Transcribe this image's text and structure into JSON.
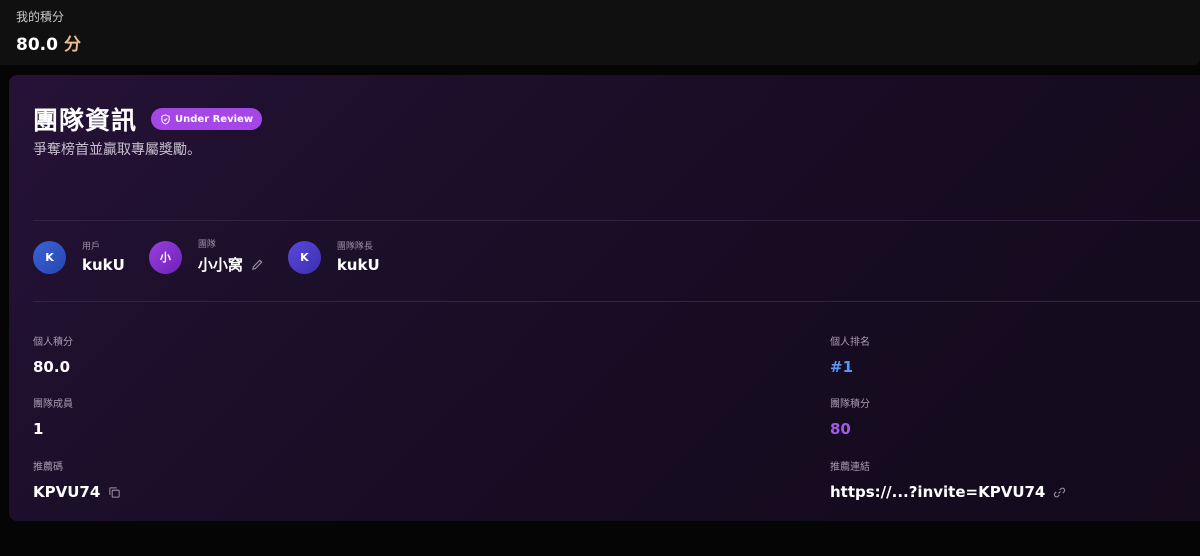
{
  "my_points": {
    "label": "我的積分",
    "value": "80.0",
    "unit": "分"
  },
  "team_card": {
    "title": "團隊資訊",
    "badge": "Under Review",
    "subtitle": "爭奪榜首並贏取專屬獎勵。",
    "members": [
      {
        "label": "用戶",
        "name": "kukU",
        "initial": "K",
        "icon": "avatar"
      },
      {
        "label": "團隊",
        "name": "小小窝",
        "initial": "小",
        "icon": "avatar",
        "edit_icon": "pencil-icon"
      },
      {
        "label": "團隊隊長",
        "name": "kukU",
        "initial": "K",
        "icon": "avatar"
      }
    ],
    "stats": {
      "personal_points": {
        "label": "個人積分",
        "value": "80.0"
      },
      "personal_rank": {
        "label": "個人排名",
        "value": "#1"
      },
      "team_members": {
        "label": "團隊成員",
        "value": "1"
      },
      "team_points": {
        "label": "團隊積分",
        "value": "80"
      },
      "referral_code": {
        "label": "推薦碼",
        "value": "KPVU74",
        "icon": "copy-icon"
      },
      "referral_link": {
        "label": "推薦連結",
        "value": "https://...?invite=KPVU74",
        "icon": "link-icon"
      }
    }
  },
  "colors": {
    "accent_purple": "#a546e6",
    "rank_blue": "#5f95ef",
    "team_points_purple": "#a45ae6",
    "points_unit": "#e6ba8e"
  }
}
